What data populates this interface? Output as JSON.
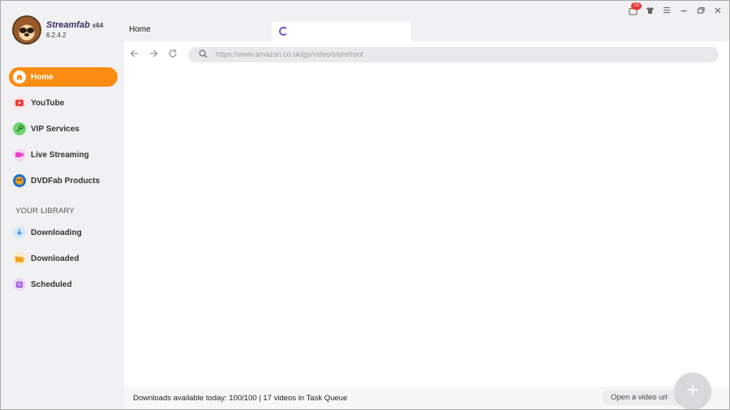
{
  "app": {
    "name": "Streamfab",
    "arch": "x64",
    "version": "6.2.4.2"
  },
  "titlebar": {
    "badge_count": "19",
    "icons": [
      "task-icon",
      "shirt-icon",
      "menu-icon",
      "minimize-icon",
      "maximize-icon",
      "close-icon"
    ]
  },
  "tabs": {
    "home_label": "Home"
  },
  "sidebar": {
    "items": [
      {
        "label": "Home",
        "icon": "house-icon",
        "color": "#fb8c12"
      },
      {
        "label": "YouTube",
        "icon": "youtube-icon",
        "color": "#f23b3b"
      },
      {
        "label": "VIP Services",
        "icon": "key-icon",
        "color": "#3cb34a"
      },
      {
        "label": "Live Streaming",
        "icon": "camera-icon",
        "color": "#e83ec9"
      },
      {
        "label": "DVDFab Products",
        "icon": "dvdfab-icon",
        "color": "#1f6fd1"
      }
    ],
    "library_title": "YOUR LIBRARY",
    "library": [
      {
        "label": "Downloading",
        "icon": "download-icon",
        "color": "#3b8be8"
      },
      {
        "label": "Downloaded",
        "icon": "folder-icon",
        "color": "#f2a01a"
      },
      {
        "label": "Scheduled",
        "icon": "calendar-icon",
        "color": "#a259d9"
      }
    ]
  },
  "browser": {
    "url": "https://www.amazon.co.uk/gp/video/storefront"
  },
  "status": {
    "text": "Downloads available today: 100/100 | 17 videos in Task Queue",
    "open_url_label": "Open a video url",
    "fab_symbol": "+"
  },
  "colors": {
    "accent": "#fb8c12",
    "spinner": "#6b5bd6"
  }
}
